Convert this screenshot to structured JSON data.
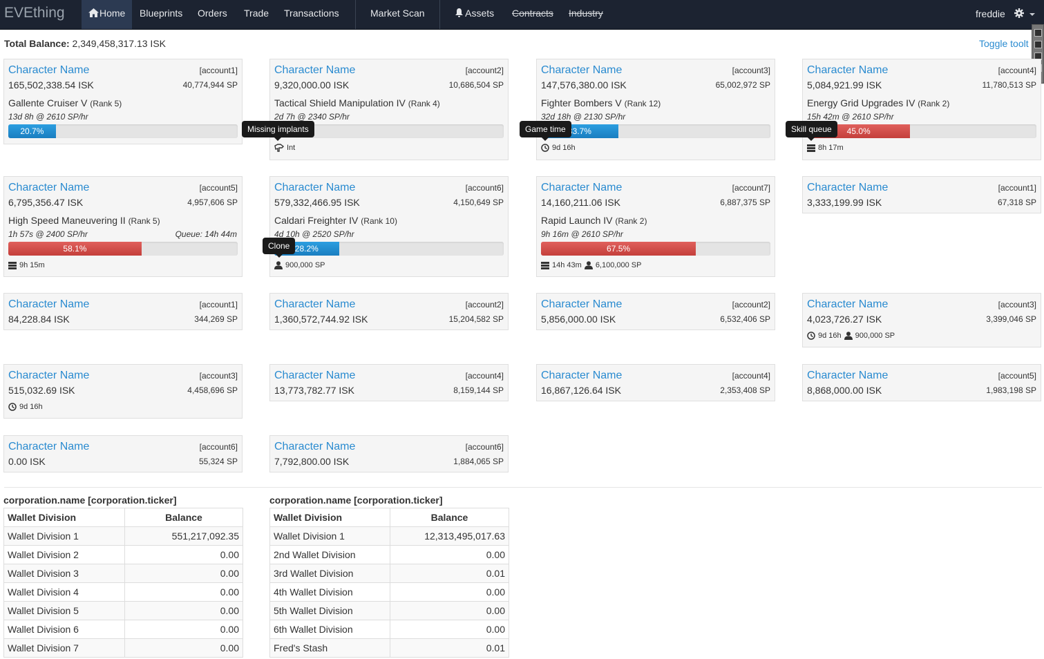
{
  "nav": {
    "brand": "EVEthing",
    "items": [
      "Home",
      "Blueprints",
      "Orders",
      "Trade",
      "Transactions",
      "Market Scan",
      "Assets",
      "Contracts",
      "Industry"
    ],
    "user": "freddie"
  },
  "header": {
    "total_label": "Total Balance:",
    "total_value": "2,349,458,317.13 ISK",
    "toggle": "Toggle toolt"
  },
  "tooltips": [
    "Missing implants",
    "Game time",
    "Skill queue",
    "Clone"
  ],
  "characters": [
    {
      "name": "Character Name",
      "account": "[account1]",
      "isk": "165,502,338.54 ISK",
      "sp": "40,774,944 SP",
      "skill": "Gallente Cruiser V",
      "rank": "(Rank 5)",
      "rate": "13d 8h @ 2610 SP/hr",
      "progress": "20.7%",
      "progress_value": 20.7,
      "color": "blue"
    },
    {
      "name": "Character Name",
      "account": "[account2]",
      "isk": "9,320,000.00 ISK",
      "sp": "10,686,504 SP",
      "skill": "Tactical Shield Manipulation IV",
      "rank": "(Rank 4)",
      "rate": "2d 7h @ 2340 SP/hr",
      "progress": "",
      "progress_value": 0,
      "color": "blue",
      "status": [
        {
          "icon": "implant-icon",
          "text": "Int"
        }
      ]
    },
    {
      "name": "Character Name",
      "account": "[account3]",
      "isk": "147,576,380.00 ISK",
      "sp": "65,002,972 SP",
      "skill": "Fighter Bombers V",
      "rank": "(Rank 12)",
      "rate": "32d 18h @ 2130 SP/hr",
      "progress": "33.7%",
      "progress_value": 33.7,
      "color": "blue",
      "status": [
        {
          "icon": "clock-icon",
          "text": "9d 16h"
        }
      ]
    },
    {
      "name": "Character Name",
      "account": "[account4]",
      "isk": "5,084,921.99 ISK",
      "sp": "11,780,513 SP",
      "skill": "Energy Grid Upgrades IV",
      "rank": "(Rank 2)",
      "rate": "15h 42m @ 2610 SP/hr",
      "progress": "45.0%",
      "progress_value": 45.0,
      "color": "red",
      "status": [
        {
          "icon": "queue-icon",
          "text": "8h 17m"
        }
      ]
    },
    {
      "name": "Character Name",
      "account": "[account5]",
      "isk": "6,795,356.47 ISK",
      "sp": "4,957,606 SP",
      "skill": "High Speed Maneuvering II",
      "rank": "(Rank 5)",
      "rate": "1h 57s @ 2400 SP/hr",
      "queue": "Queue: 14h 44m",
      "progress": "58.1%",
      "progress_value": 58.1,
      "color": "red",
      "status": [
        {
          "icon": "queue-icon",
          "text": "9h 15m"
        }
      ]
    },
    {
      "name": "Character Name",
      "account": "[account6]",
      "isk": "579,332,466.95 ISK",
      "sp": "4,150,649 SP",
      "skill": "Caldari Freighter IV",
      "rank": "(Rank 10)",
      "rate": "4d 10h @ 2520 SP/hr",
      "progress": "28.2%",
      "progress_value": 28.2,
      "color": "blue",
      "status": [
        {
          "icon": "clone-icon",
          "text": "900,000 SP"
        }
      ]
    },
    {
      "name": "Character Name",
      "account": "[account7]",
      "isk": "14,160,211.06 ISK",
      "sp": "6,887,375 SP",
      "skill": "Rapid Launch IV",
      "rank": "(Rank 2)",
      "rate": "9h 16m @ 2610 SP/hr",
      "progress": "67.5%",
      "progress_value": 67.5,
      "color": "red",
      "status": [
        {
          "icon": "queue-icon",
          "text": "14h 43m"
        },
        {
          "icon": "clone-icon",
          "text": "6,100,000 SP"
        }
      ]
    },
    {
      "name": "Character Name",
      "account": "[account1]",
      "isk": "3,333,199.99 ISK",
      "sp": "67,318 SP"
    },
    {
      "name": "Character Name",
      "account": "[account1]",
      "isk": "84,228.84 ISK",
      "sp": "344,269 SP"
    },
    {
      "name": "Character Name",
      "account": "[account2]",
      "isk": "1,360,572,744.92 ISK",
      "sp": "15,204,582 SP"
    },
    {
      "name": "Character Name",
      "account": "[account2]",
      "isk": "5,856,000.00 ISK",
      "sp": "6,532,406 SP"
    },
    {
      "name": "Character Name",
      "account": "[account3]",
      "isk": "4,023,726.27 ISK",
      "sp": "3,399,046 SP",
      "status": [
        {
          "icon": "clock-icon",
          "text": "9d 16h"
        },
        {
          "icon": "clone-icon",
          "text": "900,000 SP"
        }
      ]
    },
    {
      "name": "Character Name",
      "account": "[account3]",
      "isk": "515,032.69 ISK",
      "sp": "4,458,696 SP",
      "status": [
        {
          "icon": "clock-icon",
          "text": "9d 16h"
        }
      ]
    },
    {
      "name": "Character Name",
      "account": "[account4]",
      "isk": "13,773,782.77 ISK",
      "sp": "8,159,144 SP"
    },
    {
      "name": "Character Name",
      "account": "[account4]",
      "isk": "16,867,126.64 ISK",
      "sp": "2,353,408 SP"
    },
    {
      "name": "Character Name",
      "account": "[account5]",
      "isk": "8,868,000.00 ISK",
      "sp": "1,983,198 SP"
    },
    {
      "name": "Character Name",
      "account": "[account6]",
      "isk": "0.00 ISK",
      "sp": "55,324 SP"
    },
    {
      "name": "Character Name",
      "account": "[account6]",
      "isk": "7,792,800.00 ISK",
      "sp": "1,884,065 SP"
    }
  ],
  "corporations": [
    {
      "title": "corporation.name [corporation.ticker]",
      "col1": "Wallet Division",
      "col2": "Balance",
      "rows": [
        [
          "Wallet Division 1",
          "551,217,092.35"
        ],
        [
          "Wallet Division 2",
          "0.00"
        ],
        [
          "Wallet Division 3",
          "0.00"
        ],
        [
          "Wallet Division 4",
          "0.00"
        ],
        [
          "Wallet Division 5",
          "0.00"
        ],
        [
          "Wallet Division 6",
          "0.00"
        ],
        [
          "Wallet Division 7",
          "0.00"
        ]
      ]
    },
    {
      "title": "corporation.name [corporation.ticker]",
      "col1": "Wallet Division",
      "col2": "Balance",
      "rows": [
        [
          "Wallet Division 1",
          "12,313,495,017.63"
        ],
        [
          "2nd Wallet Division",
          "0.00"
        ],
        [
          "3rd Wallet Division",
          "0.01"
        ],
        [
          "4th Wallet Division",
          "0.00"
        ],
        [
          "5th Wallet Division",
          "0.00"
        ],
        [
          "6th Wallet Division",
          "0.00"
        ],
        [
          "Fred's Stash",
          "0.01"
        ]
      ]
    }
  ]
}
